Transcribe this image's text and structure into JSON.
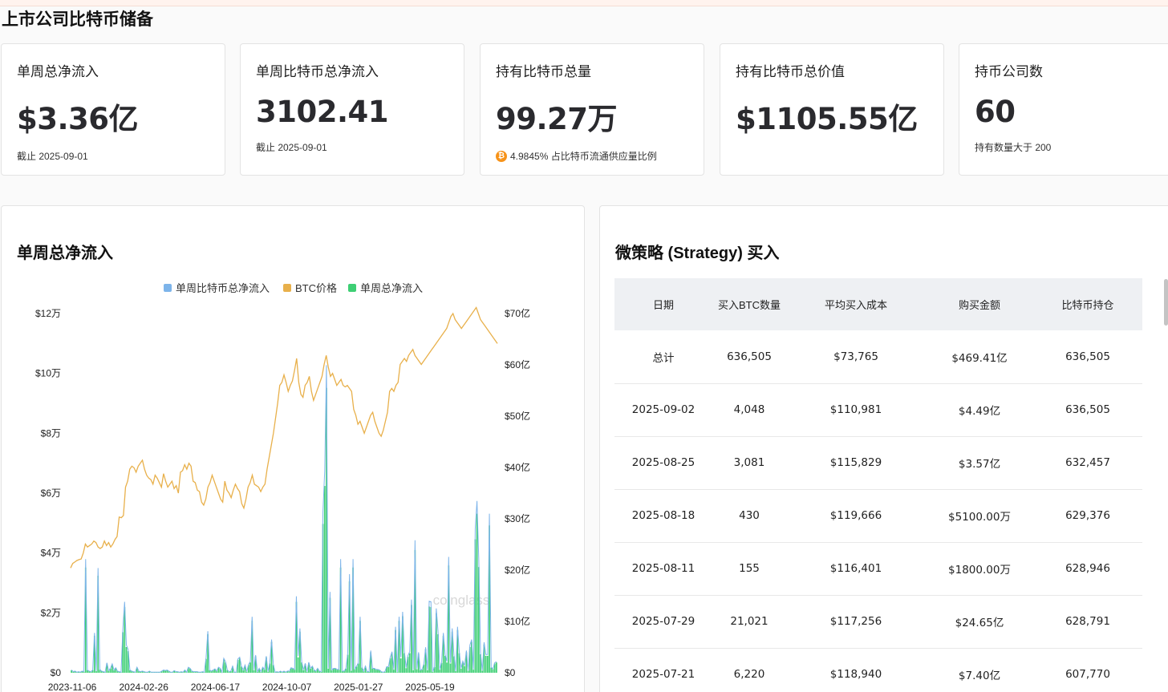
{
  "page": {
    "title": "上市公司比特币储备"
  },
  "stats": [
    {
      "label": "单周总净流入",
      "value": "$3.36亿",
      "sub": "截止 2025-09-01"
    },
    {
      "label": "单周比特币总净流入",
      "value": "3102.41",
      "sub": "截止 2025-09-01"
    },
    {
      "label": "持有比特币总量",
      "value": "99.27万",
      "sub": "4.9845% 占比特币流通供应量比例"
    },
    {
      "label": "持有比特币总价值",
      "value": "$1105.55亿",
      "sub": ""
    },
    {
      "label": "持币公司数",
      "value": "60",
      "sub": "持有数量大于 200"
    }
  ],
  "colors": {
    "btc_orange": "#f7931a",
    "series_btc_flow": "#7db4ea",
    "series_price": "#e8b04b",
    "series_usd_flow": "#3ecf74"
  },
  "icons": {
    "btc": "bitcoin-icon"
  },
  "chart_panel": {
    "title": "单周总净流入",
    "watermark": "coinglass"
  },
  "chart_data": {
    "type": "bar",
    "legend": [
      "单周比特币总净流入",
      "BTC价格",
      "单周总净流入"
    ],
    "x_ticks": [
      "2023-11-06",
      "2024-02-26",
      "2024-06-17",
      "2024-10-07",
      "2025-01-27",
      "2025-05-19"
    ],
    "y_left_ticks": [
      "$0",
      "$2万",
      "$4万",
      "$6万",
      "$8万",
      "$10万",
      "$12万"
    ],
    "y_left_range": [
      0,
      120000
    ],
    "y_right_ticks": [
      "$0",
      "$10亿",
      "$20亿",
      "$30亿",
      "$40亿",
      "$50亿",
      "$60亿",
      "$70亿"
    ],
    "y_right_range": [
      0,
      70
    ],
    "series": [
      {
        "name": "单周总净流入",
        "axis": "right",
        "unit": "亿",
        "values": [
          0.5,
          0.2,
          0.3,
          0.1,
          0.2,
          0.1,
          0.3,
          0.2,
          20.5,
          0.5,
          0.3,
          0.2,
          0.5,
          7.2,
          0.3,
          18.9,
          0.6,
          0.3,
          0.2,
          0.1,
          1.8,
          0.4,
          0.8,
          1.6,
          0.5,
          0.9,
          0.3,
          0.2,
          0.1,
          7.9,
          12.8,
          5.0,
          4.2,
          0.5,
          0.3,
          0.2,
          0.1,
          1.0,
          0.3,
          0.2,
          0.3,
          0.2,
          0.1,
          0.1,
          0.3,
          0.1,
          0.1,
          0.1,
          0.1,
          0.1,
          0.1,
          0.3,
          0.5,
          0.4,
          0.5,
          0.3,
          0.1,
          0.1,
          0.4,
          0.2,
          0.2,
          0.1,
          0.2,
          0.1,
          0.5,
          0.1,
          1.0,
          0.8,
          0.3,
          0.2,
          0.2,
          0.2,
          0.1,
          0.1,
          0.2,
          0.1,
          2.7,
          7.5,
          0.5,
          0.3,
          0.5,
          0.7,
          0.3,
          1.0,
          0.8,
          0.1,
          2.6,
          2.0,
          0.5,
          0.2,
          0.3,
          1.2,
          0.1,
          0.1,
          2.5,
          2.8,
          1.2,
          0.5,
          1.4,
          0.2,
          1.5,
          2.0,
          10.1,
          0.5,
          3.2,
          0.2,
          0.8,
          0.2,
          1.0,
          0.6,
          3.0,
          0.2,
          1.8,
          6.0,
          1.5,
          0.1,
          0.2,
          0.1,
          0.3,
          0.1,
          0.3,
          0.1,
          0.3,
          0.3,
          0.9,
          0.8,
          0.6,
          13.8,
          3.0,
          8.0,
          2.0,
          0.5,
          1.7,
          0.2,
          1.9,
          0.8,
          1.2,
          0.5,
          0.3,
          0.8,
          0.3,
          0.2,
          29.0,
          36.4,
          55.5,
          0.8,
          14.6,
          0.5,
          0.8,
          0.8,
          0.6,
          0.6,
          20.5,
          0.3,
          0.3,
          0.8,
          3.5,
          17.8,
          0.4,
          20.5,
          0.7,
          1.2,
          1.8,
          10.1,
          1.0,
          0.3,
          1.2,
          0.2,
          0.2,
          4.0,
          0.8,
          0.8,
          0.6,
          0.6,
          0.5,
          0.2,
          0.1,
          0.2,
          1.1,
          1.1,
          2.8,
          3.8,
          0.6,
          8.3,
          0.1,
          10.1,
          2.8,
          11.0,
          3.8,
          0.9,
          3.1,
          3.8,
          13.2,
          0.5,
          23.9,
          0.7,
          3.7,
          0.5,
          0.6,
          1.6,
          4.6,
          0.5,
          12.9,
          12.8,
          0.2,
          1.1,
          11.6,
          7.5,
          0.6,
          1.9,
          7.2,
          3.3,
          2.0,
          20.9,
          1.8,
          8.0,
          3.2,
          0.3,
          8.3,
          3.8,
          0.8,
          2.1,
          1.3,
          4.0,
          0.4,
          5.0,
          6.0,
          0.6,
          26.0,
          31.0,
          20.6,
          3.6,
          0.4,
          5.5,
          3.3,
          3.3,
          28.7,
          1.0,
          0.7,
          1.8,
          2.0
        ]
      },
      {
        "name": "BTC价格",
        "axis": "left",
        "unit": "USD",
        "values": [
          35000,
          36500,
          37000,
          37500,
          37800,
          38000,
          40000,
          43000,
          42000,
          42500,
          43000,
          44000,
          43500,
          42000,
          41500,
          42000,
          44000,
          42500,
          43500,
          42000,
          43000,
          44500,
          45500,
          52000,
          51800,
          52500,
          62000,
          64000,
          68000,
          69000,
          68500,
          67000,
          69000,
          70000,
          71000,
          68000,
          66000,
          65000,
          64500,
          63000,
          66000,
          65000,
          63500,
          62000,
          66500,
          64000,
          62000,
          63000,
          64000,
          61500,
          62500,
          60000,
          67000,
          67500,
          69500,
          68000,
          70000,
          69000,
          64000,
          63500,
          61000,
          60500,
          57000,
          56000,
          58000,
          62000,
          63500,
          66000,
          64000,
          62000,
          60000,
          58000,
          57000,
          64000,
          61000,
          60000,
          58500,
          61000,
          63000,
          61500,
          60500,
          56500,
          55000,
          58000,
          62000,
          63500,
          66000,
          63000,
          62500,
          62000,
          60500,
          62000,
          63000,
          68000,
          72000,
          76000,
          80000,
          85000,
          90000,
          96000,
          97000,
          99500,
          97000,
          94000,
          96000,
          97500,
          101000,
          105000,
          97000,
          93000,
          92000,
          96000,
          97000,
          99000,
          94000,
          91000,
          93000,
          95000,
          97000,
          99000,
          103000,
          106000,
          102000,
          99000,
          100000,
          98000,
          96000,
          97000,
          98000,
          96000,
          95500,
          96000,
          95000,
          94000,
          88000,
          86000,
          83000,
          84000,
          82000,
          80000,
          82000,
          84000,
          86000,
          87000,
          84000,
          82000,
          80000,
          79000,
          81000,
          84000,
          87000,
          94000,
          95000,
          94000,
          96000,
          97000,
          103000,
          104000,
          105000,
          104000,
          106000,
          107000,
          108000,
          106000,
          105000,
          104000,
          103000,
          104000,
          105000,
          106000,
          107000,
          108000,
          109000,
          110000,
          111000,
          112000,
          113000,
          114000,
          115000,
          117000,
          119000,
          120000,
          118000,
          117000,
          116000,
          115000,
          116000,
          117000,
          118000,
          119000,
          120000,
          121000,
          122000,
          120000,
          118000,
          117000,
          116000,
          115000,
          114000,
          113000,
          112000,
          111000,
          110000
        ]
      }
    ]
  },
  "table_panel": {
    "title": "微策略 (Strategy) 买入",
    "columns": [
      "日期",
      "买入BTC数量",
      "平均买入成本",
      "购买金额",
      "比特币持仓"
    ],
    "rows": [
      [
        "总计",
        "636,505",
        "$73,765",
        "$469.41亿",
        "636,505"
      ],
      [
        "2025-09-02",
        "4,048",
        "$110,981",
        "$4.49亿",
        "636,505"
      ],
      [
        "2025-08-25",
        "3,081",
        "$115,829",
        "$3.57亿",
        "632,457"
      ],
      [
        "2025-08-18",
        "430",
        "$119,666",
        "$5100.00万",
        "629,376"
      ],
      [
        "2025-08-11",
        "155",
        "$116,401",
        "$1800.00万",
        "628,946"
      ],
      [
        "2025-07-29",
        "21,021",
        "$117,256",
        "$24.65亿",
        "628,791"
      ],
      [
        "2025-07-21",
        "6,220",
        "$118,940",
        "$7.40亿",
        "607,770"
      ]
    ]
  }
}
